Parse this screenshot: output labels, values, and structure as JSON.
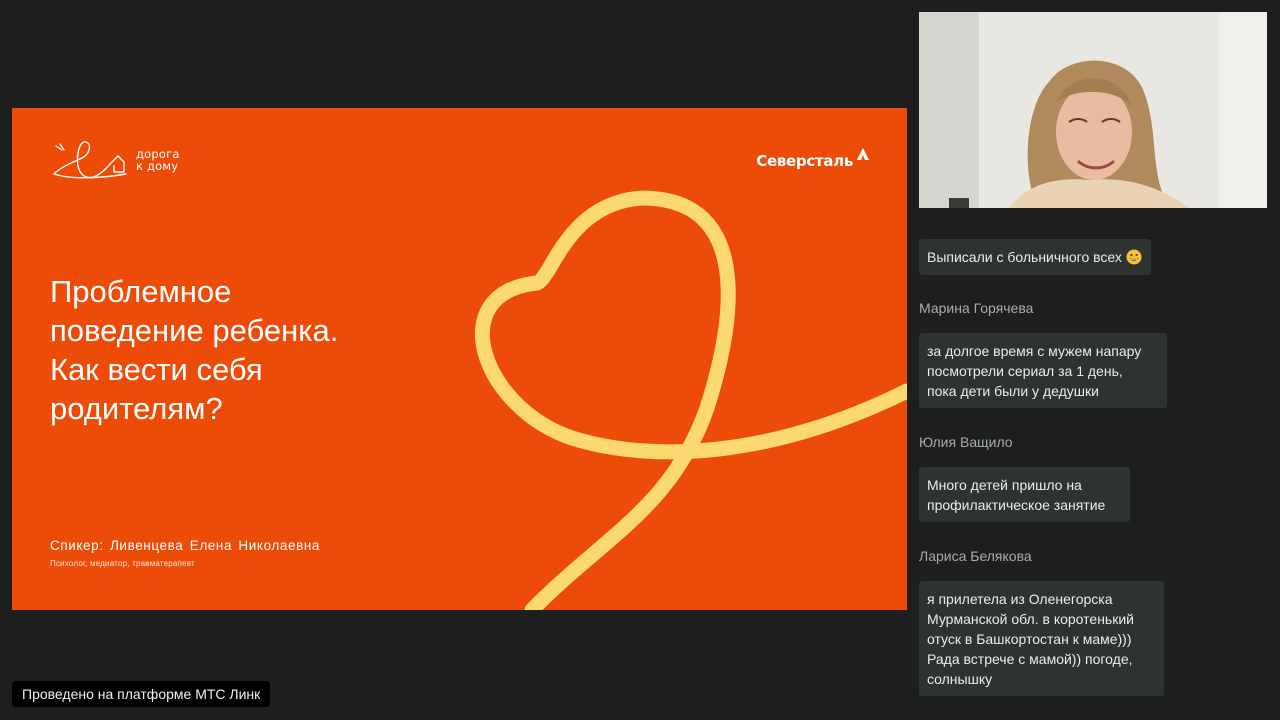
{
  "slide": {
    "brand_left": {
      "line1": "дорога",
      "line2": "к дому"
    },
    "brand_right": {
      "name": "Северсталь"
    },
    "title_lines": [
      "Проблемное",
      "поведение ребенка.",
      "Как вести себя",
      "родителям?"
    ],
    "speaker": {
      "line1": "Спикер: Ливенцева Елена Николаевна",
      "line2": "Психолог, медиатор, травматерапевт"
    },
    "colors": {
      "background": "#ed4b08",
      "ribbon": "#fbd970"
    }
  },
  "chat": {
    "messages": [
      {
        "author": "",
        "text_lines": [
          "Выписали с больничного всех"
        ],
        "emoji": "grinning-face-icon"
      },
      {
        "author": "Марина Горячева",
        "text_lines": [
          "за долгое время с мужем напару",
          "посмотрели сериал за 1 день,",
          "пока дети были у дедушки"
        ]
      },
      {
        "author": "Юлия Ващило",
        "text_lines": [
          "Много детей пришло на",
          "профилактическое занятие"
        ]
      },
      {
        "author": "Лариса Белякова",
        "text_lines": [
          "я прилетела из Оленегорска",
          "Мурманской обл. в коротенький",
          "отуск в Башкортостан к маме)))",
          "Рада встрече с мамой)) погоде,",
          "солнышку"
        ]
      }
    ]
  },
  "footer": {
    "platform_label": "Проведено на платформе МТС Линк"
  }
}
